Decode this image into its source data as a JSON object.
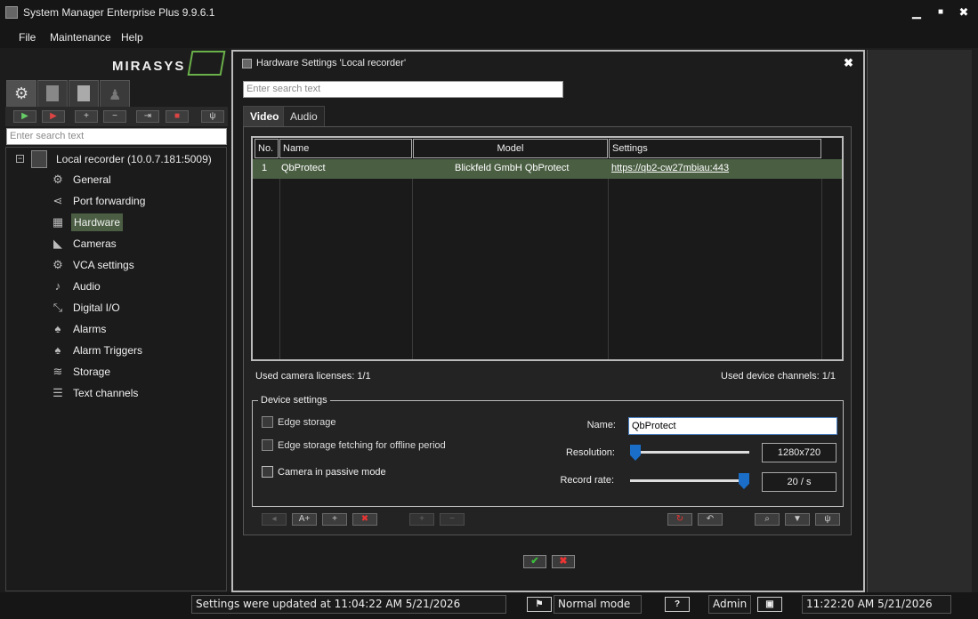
{
  "window": {
    "title": "System Manager Enterprise Plus 9.9.6.1",
    "minimize": "▁",
    "maximize": "■",
    "close": "✖"
  },
  "menu": {
    "file": "File",
    "maintenance": "Maintenance",
    "help": "Help"
  },
  "logo": {
    "text": "MIRASYS"
  },
  "left": {
    "search_placeholder": "Enter search text",
    "root_label": "Local recorder (10.0.7.181:5009)",
    "root_toggle": "−",
    "items": [
      {
        "label": "General",
        "icon": "⚙"
      },
      {
        "label": "Port forwarding",
        "icon": "⋖"
      },
      {
        "label": "Hardware",
        "icon": "▦"
      },
      {
        "label": "Cameras",
        "icon": "◣"
      },
      {
        "label": "VCA settings",
        "icon": "⚙"
      },
      {
        "label": "Audio",
        "icon": "♪"
      },
      {
        "label": "Digital I/O",
        "icon": "⤡"
      },
      {
        "label": "Alarms",
        "icon": "♠"
      },
      {
        "label": "Alarm Triggers",
        "icon": "♠"
      },
      {
        "label": "Storage",
        "icon": "≋"
      },
      {
        "label": "Text channels",
        "icon": "☰"
      }
    ]
  },
  "dialog": {
    "title": "Hardware Settings 'Local recorder'",
    "close": "✖",
    "search_placeholder": "Enter search text",
    "tabs": [
      "Video",
      "Audio"
    ],
    "table": {
      "headers": {
        "no": "No.",
        "name": "Name",
        "model": "Model",
        "settings": "Settings"
      },
      "rows": [
        {
          "no": "1",
          "name": "QbProtect",
          "model": "Blickfeld GmbH QbProtect",
          "settings": "https://qb2-cw27mbiau:443"
        }
      ]
    },
    "used_licenses": "Used camera licenses: 1/1",
    "used_channels": "Used device channels: 1/1",
    "device_settings": {
      "title": "Device settings",
      "edge_storage": "Edge storage",
      "edge_fetch": "Edge storage fetching for offline period",
      "passive_mode": "Camera in passive mode",
      "name_label": "Name:",
      "name_value": "QbProtect",
      "resolution_label": "Resolution:",
      "resolution_value": "1280x720",
      "resolution_level": 0,
      "record_rate_label": "Record rate:",
      "record_rate_value": "20 / s",
      "record_rate_level": 1
    },
    "ok": "✔",
    "cancel": "✖"
  },
  "status": {
    "updated": "Settings were updated at 11:04:22 AM 5/21/2026",
    "mode": "Normal mode",
    "help": "?",
    "user": "Admin",
    "clock": "11:22:20 AM 5/21/2026"
  }
}
